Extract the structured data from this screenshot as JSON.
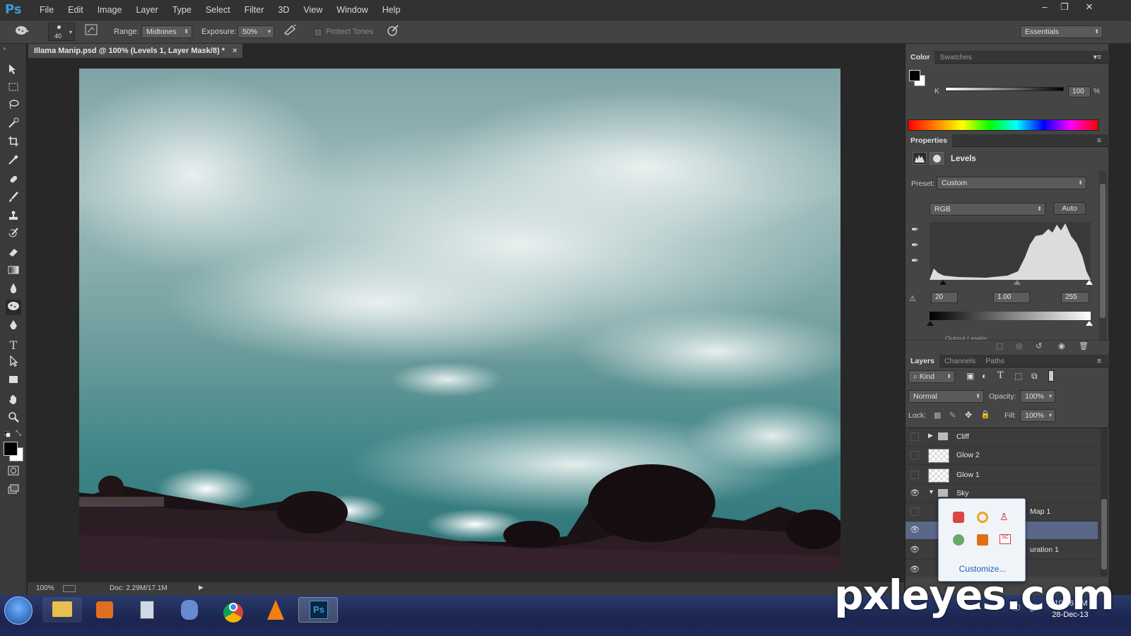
{
  "app": {
    "logo": "Ps",
    "menu": [
      "File",
      "Edit",
      "Image",
      "Layer",
      "Type",
      "Select",
      "Filter",
      "3D",
      "View",
      "Window",
      "Help"
    ],
    "window_buttons": [
      "–",
      "❐",
      "✕"
    ]
  },
  "options": {
    "brush_size": "40",
    "range_label": "Range:",
    "range_value": "Midtones",
    "exposure_label": "Exposure:",
    "exposure_value": "50%",
    "protect_tones_label": "Protect Tones",
    "protect_tones_checked": false,
    "workspace": "Essentials"
  },
  "document": {
    "tab_title": "Illama Manip.psd @ 100% (Levels 1, Layer Mask/8) *",
    "close": "×"
  },
  "status": {
    "zoom": "100%",
    "doc_info": "Doc: 2.29M/17.1M"
  },
  "color_panel": {
    "tabs": [
      "Color",
      "Swatches"
    ],
    "channel": "K",
    "value": "100",
    "unit": "%"
  },
  "properties": {
    "tab": "Properties",
    "title": "Levels",
    "preset_label": "Preset:",
    "preset_value": "Custom",
    "channel_value": "RGB",
    "auto_label": "Auto",
    "input_black": "20",
    "input_gamma": "1.00",
    "input_white": "255",
    "output_label": "Output Levels:"
  },
  "layers_panel": {
    "tabs": [
      "Layers",
      "Channels",
      "Paths"
    ],
    "filter_label": "Kind",
    "blend_mode": "Normal",
    "opacity_label": "Opacity:",
    "opacity_value": "100%",
    "lock_label": "Lock:",
    "fill_label": "Fill:",
    "fill_value": "100%",
    "layers": [
      {
        "name": "Cliff",
        "visible": false,
        "type": "group"
      },
      {
        "name": "Glow 2",
        "visible": false,
        "type": "layer"
      },
      {
        "name": "Glow 1",
        "visible": false,
        "type": "layer"
      },
      {
        "name": "Sky",
        "visible": true,
        "type": "group"
      },
      {
        "name": "Map 1",
        "visible": false,
        "type": "adjustment"
      },
      {
        "name": "",
        "visible": true,
        "type": "adjustment"
      },
      {
        "name": "uration 1",
        "visible": true,
        "type": "adjustment"
      },
      {
        "name": "",
        "visible": true,
        "type": "layer"
      }
    ]
  },
  "tray_popup": {
    "customize": "Customize..."
  },
  "taskbar": {
    "time": "10:06 PM",
    "date": "28-Dec-13"
  },
  "watermark": "pxleyes.com",
  "colors": {
    "accent": "#3a9ad9",
    "panel": "#454545",
    "taskbar": "#1b2550"
  }
}
